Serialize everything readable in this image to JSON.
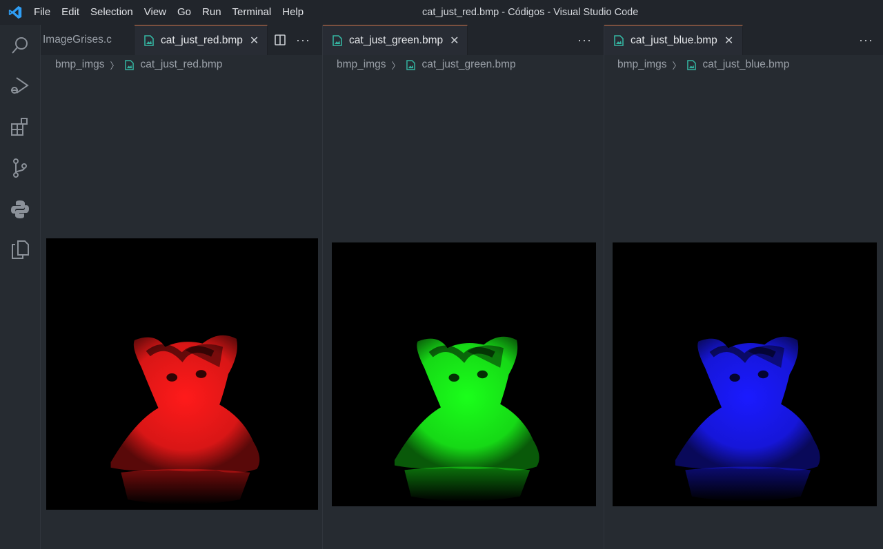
{
  "titlebar": {
    "menu": [
      "File",
      "Edit",
      "Selection",
      "View",
      "Go",
      "Run",
      "Terminal",
      "Help"
    ],
    "window_title": "cat_just_red.bmp - Códigos - Visual Studio Code"
  },
  "activitybar": {
    "icons": [
      "search-icon",
      "run-debug-icon",
      "extensions-icon",
      "source-control-icon",
      "python-icon",
      "explorer-icon"
    ]
  },
  "groups": [
    {
      "tabs": [
        {
          "label": "ImageGrises.c",
          "active": false,
          "close": false
        },
        {
          "label": "cat_just_red.bmp",
          "active": true,
          "close": true
        }
      ],
      "breadcrumb": {
        "folder": "bmp_imgs",
        "file": "cat_just_red.bmp"
      },
      "image": {
        "channel": "red",
        "color": "#ff1a1a"
      }
    },
    {
      "tabs": [
        {
          "label": "cat_just_green.bmp",
          "active": true,
          "close": true
        }
      ],
      "breadcrumb": {
        "folder": "bmp_imgs",
        "file": "cat_just_green.bmp"
      },
      "image": {
        "channel": "green",
        "color": "#1aff1a"
      }
    },
    {
      "tabs": [
        {
          "label": "cat_just_blue.bmp",
          "active": true,
          "close": true
        }
      ],
      "breadcrumb": {
        "folder": "bmp_imgs",
        "file": "cat_just_blue.bmp"
      },
      "image": {
        "channel": "blue",
        "color": "#1a1aff"
      }
    }
  ],
  "symbols": {
    "close": "✕",
    "chevron": "〉",
    "more": "···"
  },
  "colors": {
    "accent_tab_border": "#d4774b",
    "file_icon": "#34b3a0",
    "vscode_blue": "#2f9ef5"
  }
}
